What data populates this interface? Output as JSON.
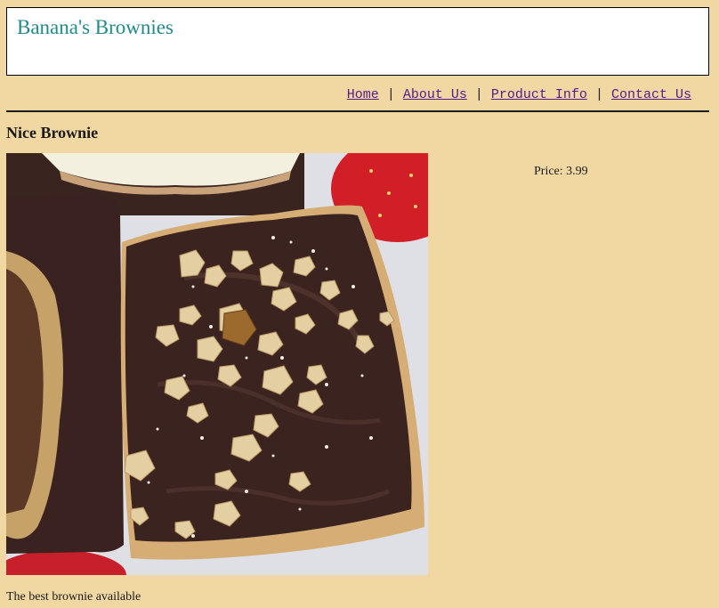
{
  "site": {
    "title": "Banana's Brownies"
  },
  "nav": {
    "items": [
      {
        "label": "Home"
      },
      {
        "label": "About Us"
      },
      {
        "label": "Product Info"
      },
      {
        "label": "Contact Us"
      }
    ],
    "separator": "|"
  },
  "product": {
    "name": "Nice Brownie",
    "price_label": "Price:",
    "price_value": "3.99",
    "description": "The best brownie available",
    "image_subject": "brownie-photo"
  },
  "colors": {
    "page_background": "#f1d8a2",
    "title_color": "#238a8a",
    "link_color": "#551a8b"
  }
}
